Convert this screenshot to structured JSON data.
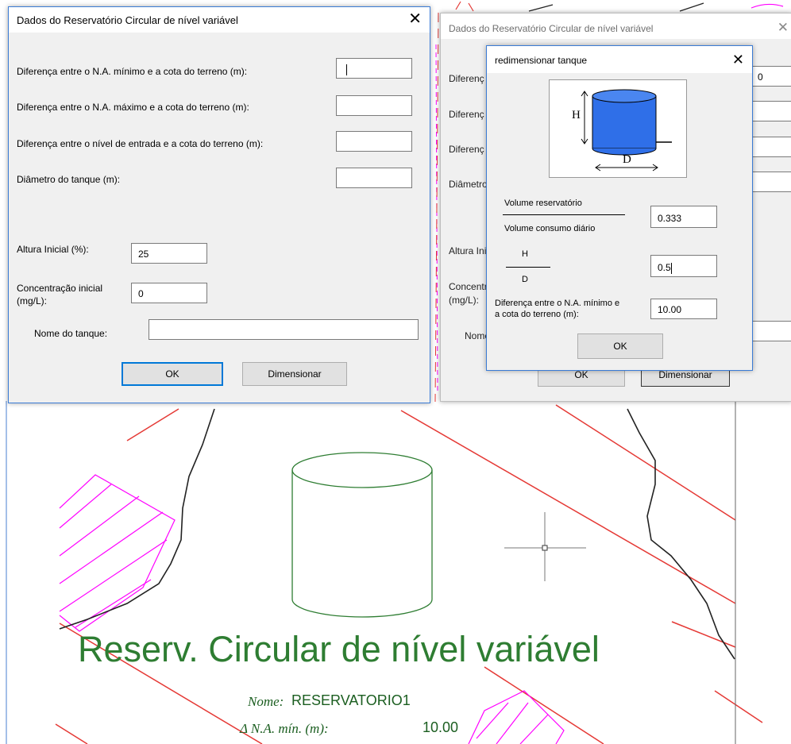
{
  "dialog_main": {
    "title": "Dados do Reservatório Circular de nível variável",
    "close_label": "✕",
    "labels": {
      "na_min": "Diferença entre o N.A. mínimo e a cota do terreno (m):",
      "na_max": "Diferença entre o N.A. máximo e a cota do terreno (m):",
      "entrada": "Diferença entre o nível de entrada e a cota do terreno (m):",
      "diametro": "Diâmetro do tanque (m):",
      "altura_inicial": "Altura Inicial (%):",
      "concentracao_1": "Concentração inicial",
      "concentracao_2": "(mg/L):",
      "nome": "Nome do tanque:"
    },
    "values": {
      "na_min": "",
      "na_max": "",
      "entrada": "",
      "diametro": "",
      "altura_inicial": "25",
      "concentracao": "0",
      "nome": ""
    },
    "buttons": {
      "ok": "OK",
      "dimensionar": "Dimensionar"
    }
  },
  "dialog_back": {
    "title": "Dados do Reservatório Circular de nível variável",
    "close_label": "✕",
    "labels": {
      "diferenca_1": "Diferenç",
      "diferenca_2": "Diferenç",
      "diferenca_3": "Diferenç",
      "diametro": "Diâmetro",
      "altura": "Altura Ini",
      "concentr_1": "Concentr",
      "concentr_2": "(mg/L):",
      "nome": "Nome"
    },
    "field_peek": "0",
    "buttons": {
      "ok": "OK",
      "dimensionar": "Dimensionar"
    }
  },
  "dialog_redim": {
    "title": "redimensionar tanque",
    "close_label": "✕",
    "diagram": {
      "h_label": "H",
      "d_label": "D",
      "tank_color": "#2f6fe8"
    },
    "labels": {
      "volume_reservatorio": "Volume reservatório",
      "volume_consumo": "Volume consumo diário",
      "h": "H",
      "d": "D",
      "diferenca_1": "Diferença entre o N.A. mínimo e",
      "diferenca_2": "a cota do terreno (m):"
    },
    "values": {
      "volume_ratio": "0.333",
      "hd_ratio": "0.5",
      "na_min": "10.00"
    },
    "buttons": {
      "ok": "OK"
    }
  },
  "cad": {
    "title": "Reserv. Circular de nível variável",
    "name_label": "Nome:",
    "name_value": "RESERVATORIO1",
    "na_label": "Δ N.A. mín. (m):",
    "na_value": "10.00",
    "colors": {
      "text": "#2e7d32",
      "red_lines": "#e53935",
      "hatch": "#ff00ff",
      "terrain": "#222222"
    }
  }
}
